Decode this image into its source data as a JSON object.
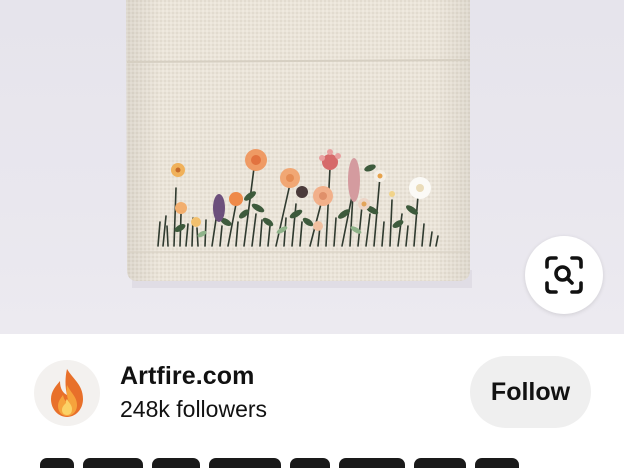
{
  "pin": {
    "image_alt": "Embroidered linen bag with wildflowers",
    "visual_search_icon": "lens-search-icon",
    "colors": {
      "background": "#e8e6ed",
      "linen": "#e9e3d8",
      "flower_orange": "#ef9a64",
      "flower_pink": "#d98d94",
      "stem_green": "#3f5a3a"
    }
  },
  "creator": {
    "name": "Artfire.com",
    "followers": "248k followers",
    "avatar_icon": "artfire-flame-icon",
    "follow_label": "Follow"
  }
}
